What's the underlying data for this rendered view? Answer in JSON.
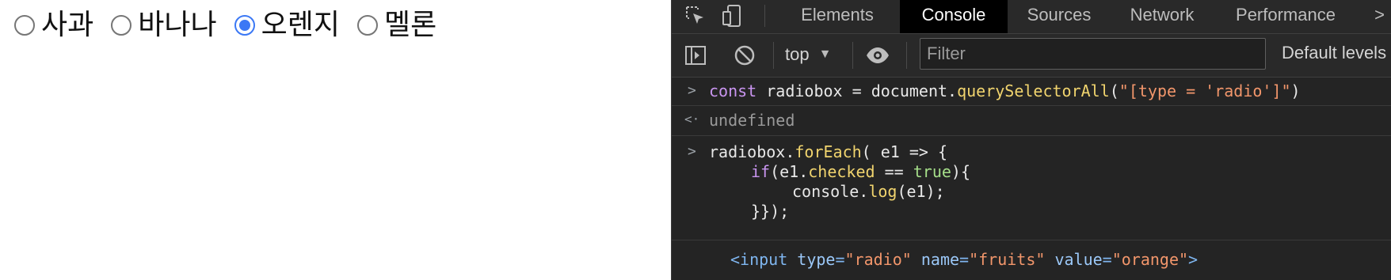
{
  "page": {
    "radios": [
      {
        "label": "사과",
        "checked": false
      },
      {
        "label": "바나나",
        "checked": false
      },
      {
        "label": "오렌지",
        "checked": true
      },
      {
        "label": "멜론",
        "checked": false
      }
    ]
  },
  "devtools": {
    "tabs": [
      "Elements",
      "Console",
      "Sources",
      "Network",
      "Performance"
    ],
    "active_tab": "Console",
    "overflow_glyph": ">",
    "toolbar": {
      "context": "top",
      "filter_placeholder": "Filter",
      "levels": "Default levels"
    },
    "console": {
      "entry1": {
        "prompt": ">",
        "kw": "const",
        "mid": " radiobox = document.",
        "fn": "querySelectorAll",
        "open": "(",
        "str": "\"[type = 'radio']\"",
        "close": ")"
      },
      "result1": {
        "prompt": "<·",
        "text": "undefined"
      },
      "entry2": {
        "prompt": ">",
        "l1a": "radiobox.",
        "l1fn": "forEach",
        "l1b": "( e1 => {",
        "l2kw": "if",
        "l2a": "(e1.",
        "l2prop": "checked",
        "l2b": " == ",
        "l2bool": "true",
        "l2c": "){",
        "l3a": "console.",
        "l3fn": "log",
        "l3b": "(e1);",
        "l4": "}});"
      },
      "output": {
        "open": "<input",
        "a1": "type",
        "v1": "\"radio\"",
        "a2": "name",
        "v2": "\"fruits\"",
        "a3": "value",
        "v3": "\"orange\"",
        "close": ">"
      }
    }
  },
  "colors": {
    "radio_accent": "#3b78f5",
    "devtools_bg": "#242424",
    "keyword": "#c995f0",
    "function": "#f1d46e",
    "string": "#f2966b"
  }
}
